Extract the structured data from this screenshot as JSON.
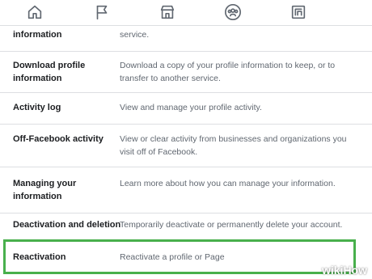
{
  "nav": {
    "icons": [
      "home-icon",
      "flag-icon",
      "marketplace-icon",
      "groups-icon",
      "gaming-icon"
    ]
  },
  "rows": [
    {
      "title": "information",
      "desc": "service."
    },
    {
      "title": "Download profile information",
      "desc": "Download a copy of your profile information to keep, or to transfer to another service."
    },
    {
      "title": "Activity log",
      "desc": "View and manage your profile activity."
    },
    {
      "title": "Off-Facebook activity",
      "desc": "View or clear activity from businesses and organizations you visit off of Facebook."
    },
    {
      "title": "Managing your information",
      "desc": "Learn more about how you can manage your information."
    },
    {
      "title": "Deactivation and deletion",
      "desc": "Temporarily deactivate or permanently delete your account."
    },
    {
      "title": "Reactivation",
      "desc": "Reactivate a profile or Page"
    }
  ],
  "watermark": {
    "wiki": "wiki",
    "how": "How"
  },
  "colors": {
    "highlight": "#48b04c",
    "divider": "#dddfe2",
    "muted": "#606770"
  }
}
